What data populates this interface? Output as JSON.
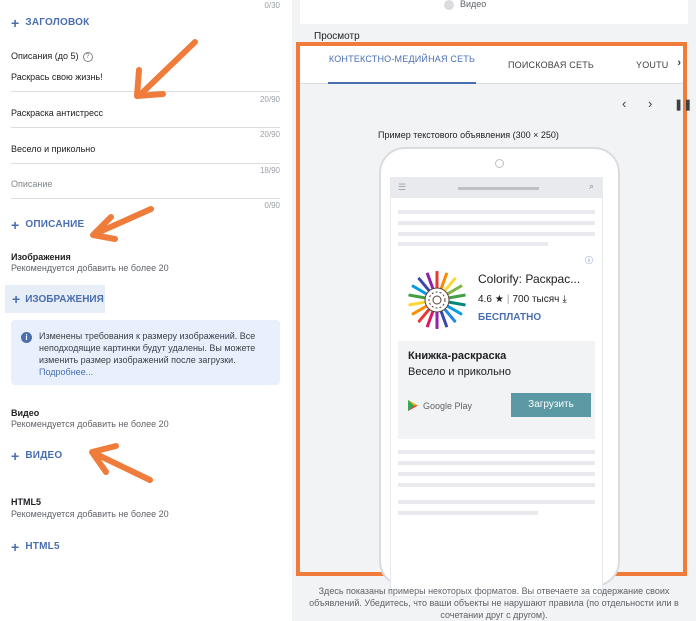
{
  "left": {
    "headlines_counter": "0/30",
    "add_headline": "ЗАГОЛОВОК",
    "descriptions_title": "Описания (до 5)",
    "descriptions": [
      {
        "value": "Раскрась свою жизнь!",
        "counter": "20/90"
      },
      {
        "value": "Раскраска антистресс",
        "counter": "20/90"
      },
      {
        "value": "Весело и прикольно",
        "counter": "18/90"
      },
      {
        "placeholder": "Описание",
        "counter": "0/90"
      }
    ],
    "add_description": "ОПИСАНИЕ",
    "images_title": "Изображения",
    "images_sub": "Рекомендуется добавить не более 20",
    "add_images": "ИЗОБРАЖЕНИЯ",
    "info_text": "Изменены требования к размеру изображений. Все неподходящие картинки будут удалены. Вы можете изменить размер изображений после загрузки.",
    "info_more": "Подробнее...",
    "video_title": "Видео",
    "video_sub": "Рекомендуется добавить не более 20",
    "add_video": "ВИДЕО",
    "html5_title": "HTML5",
    "html5_sub": "Рекомендуется добавить не более 20",
    "add_html5": "HTML5"
  },
  "right": {
    "video_label": "Видео",
    "preview_label": "Просмотр",
    "tabs": [
      {
        "label": "КОНТЕКСТНО-МЕДИЙНАЯ СЕТЬ",
        "active": true
      },
      {
        "label": "ПОИСКОВАЯ СЕТЬ",
        "active": false
      },
      {
        "label": "YOUTU",
        "active": false
      }
    ],
    "ad_caption": "Пример текстового объявления (300 × 250)",
    "ad": {
      "app_name": "Colorify: Раскрас...",
      "rating": "4.6",
      "installs": "700 тысяч",
      "price": "БЕСПЛАТНО",
      "headline": "Книжка-раскраска",
      "description": "Весело и прикольно",
      "store": "Google Play",
      "install_button": "Загрузить"
    },
    "footer_note": "Здесь показаны примеры некоторых форматов. Вы отвечаете за содержание своих объявлений. Убедитесь, что ваши объекты не нарушают правила (по отдельности или в сочетании друг с другом)."
  },
  "colors": {
    "accent": "#4a6fb0",
    "highlight_frame": "#f07c3c",
    "install_button": "#5b9aa5"
  }
}
